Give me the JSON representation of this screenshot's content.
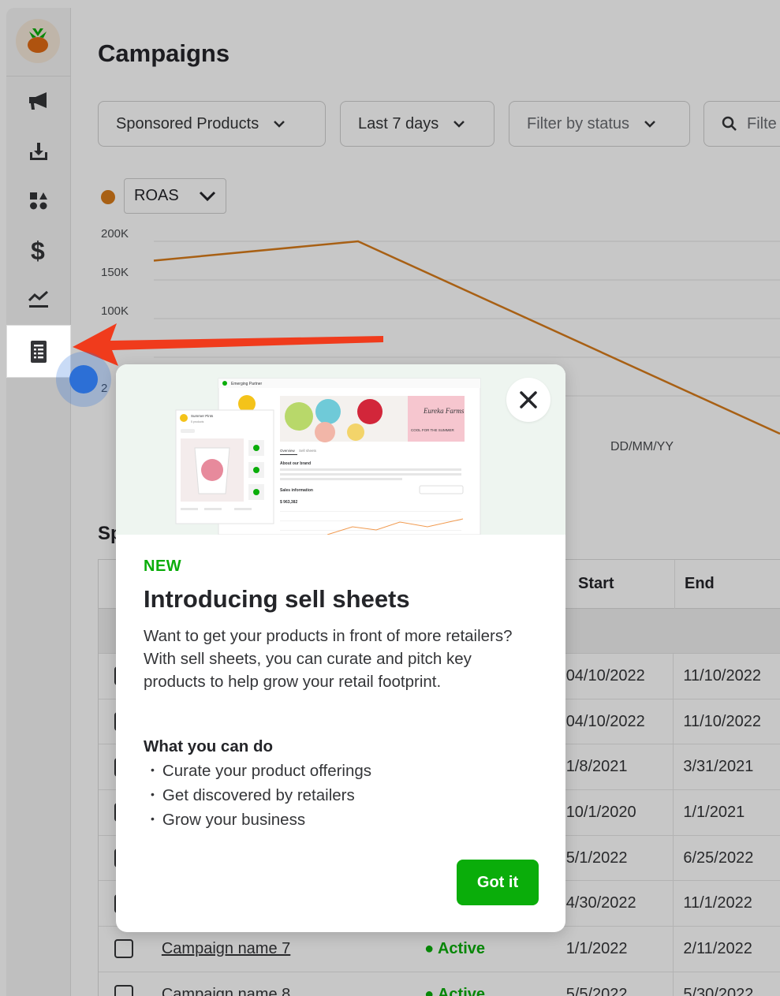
{
  "page": {
    "title": "Campaigns"
  },
  "filters": {
    "ad_type": "Sponsored Products",
    "date_range": "Last 7 days",
    "status": "Filter by status",
    "search_placeholder": "Filte"
  },
  "chart": {
    "metric": "ROAS",
    "metric_color": "#d87b1a",
    "y_ticks": [
      "200K",
      "150K",
      "100K",
      "2"
    ],
    "x_label": "DD/MM/YY"
  },
  "chart_data": {
    "type": "line",
    "title": "",
    "xlabel": "DD/MM/YY",
    "ylabel": "",
    "ylim": [
      0,
      200000
    ],
    "series": [
      {
        "name": "ROAS",
        "color": "#d87b1a",
        "x": [
          0,
          1,
          2
        ],
        "values": [
          175000,
          200000,
          70000
        ]
      }
    ]
  },
  "section": {
    "title": "Sp"
  },
  "table": {
    "headers": {
      "start": "Start",
      "end": "End"
    },
    "rows": [
      {
        "name": "",
        "status": "",
        "start": "04/10/2022",
        "end": "11/10/2022"
      },
      {
        "name": "",
        "status": "",
        "start": "04/10/2022",
        "end": "11/10/2022"
      },
      {
        "name": "",
        "status": "",
        "start": "1/8/2021",
        "end": "3/31/2021"
      },
      {
        "name": "",
        "status": "",
        "start": "10/1/2020",
        "end": "1/1/2021"
      },
      {
        "name": "",
        "status": "",
        "start": "5/1/2022",
        "end": "6/25/2022"
      },
      {
        "name": "",
        "status": "",
        "start": "4/30/2022",
        "end": "11/1/2022"
      },
      {
        "name": "Campaign name 7",
        "status": "● Active",
        "start": "1/1/2022",
        "end": "2/11/2022"
      },
      {
        "name": "Campaign name 8",
        "status": "● Active",
        "start": "5/5/2022",
        "end": "5/30/2022"
      }
    ]
  },
  "modal": {
    "badge": "NEW",
    "title": "Introducing sell sheets",
    "body": "Want to get your products in front of more retailers? With sell sheets, you can curate and pitch key products to help grow your retail footprint.",
    "subheading": "What you can do",
    "bullets": [
      "Curate your product offerings",
      "Get discovered by retailers",
      "Grow your business"
    ],
    "cta": "Got it",
    "hero": {
      "app_name": "Emerging Partner",
      "brand_name": "Summer Pints",
      "brand_sub": "5 products",
      "tab_overview": "Overview",
      "tab_sell_sheets": "Sell sheets",
      "about": "About our brand",
      "sales_info": "Sales information",
      "sales_value": "$ 963,382",
      "promo_brand": "Eureka Farms",
      "promo_tag": "COOL FOR THE SUMMER"
    }
  },
  "nav": {
    "items": [
      "megaphone-icon",
      "download-icon",
      "shapes-icon",
      "dollar-icon",
      "chart-icon",
      "sell-sheet-icon"
    ]
  }
}
